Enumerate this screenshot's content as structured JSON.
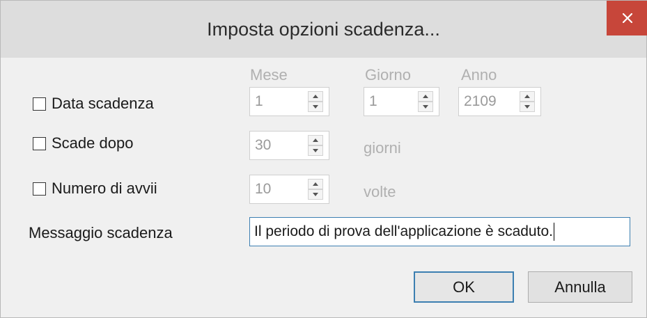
{
  "dialog": {
    "title": "Imposta opzioni scadenza...",
    "close_icon": "close-x-icon"
  },
  "columns": {
    "month": "Mese",
    "day": "Giorno",
    "year": "Anno"
  },
  "expiry_date": {
    "label": "Data scadenza",
    "checked": false,
    "month": "1",
    "day": "1",
    "year": "2109"
  },
  "expire_after": {
    "label": "Scade dopo",
    "checked": false,
    "value": "30",
    "unit": "giorni"
  },
  "launch_count": {
    "label": "Numero di avvii",
    "checked": false,
    "value": "10",
    "unit": "volte"
  },
  "message": {
    "label": "Messaggio scadenza",
    "value": "Il periodo di prova dell'applicazione è scaduto."
  },
  "buttons": {
    "ok": "OK",
    "cancel": "Annulla"
  },
  "colors": {
    "close_button": "#c7463a",
    "focus_border": "#3c7fb1",
    "titlebar": "#dddddd",
    "body": "#f0f0f0",
    "disabled_text": "#b0b0b0"
  }
}
